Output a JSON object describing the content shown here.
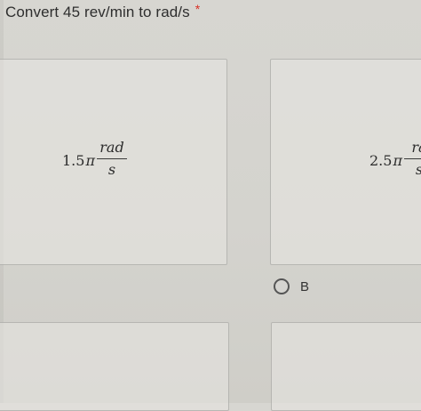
{
  "question": {
    "title": "Convert 45 rev/min to rad/s",
    "required_mark": "*"
  },
  "options": [
    {
      "coefficient": "1.5",
      "pi": "π",
      "numerator": "rad",
      "denominator": "s"
    },
    {
      "coefficient": "2.5",
      "pi": "π",
      "numerator": "ra",
      "denominator": "s"
    }
  ],
  "selected_option_hint": {
    "label": "B"
  },
  "colors": {
    "background": "#d6d5d0",
    "required": "#d93025",
    "text": "#2e2e2e"
  }
}
